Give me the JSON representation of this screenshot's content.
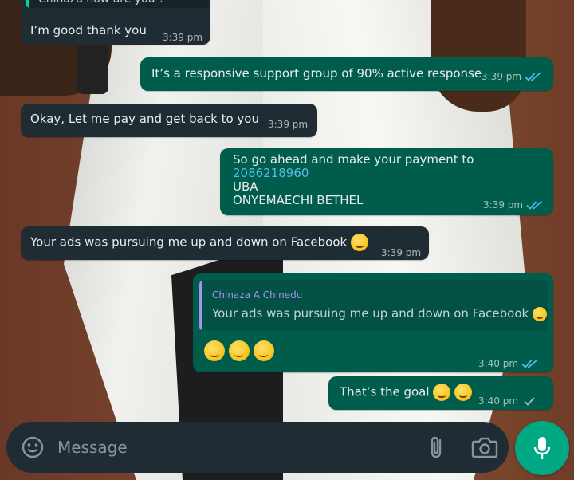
{
  "colors": {
    "incoming_bubble": "#202c33",
    "outgoing_bubble": "#005c4b",
    "read_ticks": "#53bdeb",
    "link": "#53bdeb",
    "reply_author": "#a791f0",
    "mic_button": "#00a884"
  },
  "messages": [
    {
      "direction": "in",
      "quoted_text": "Chinaza how are you ?",
      "text": "I’m good thank you",
      "time": "3:39 pm"
    },
    {
      "direction": "out",
      "text": "It’s a responsive support group of 90% active response",
      "time": "3:39 pm",
      "status": "read"
    },
    {
      "direction": "in",
      "text": "Okay, Let me pay and get back to you",
      "time": "3:39 pm"
    },
    {
      "direction": "out",
      "lines": [
        "So go ahead and make your payment to",
        "2086218960",
        "UBA",
        "ONYEMAECHI BETHEL"
      ],
      "time": "3:39 pm",
      "status": "read"
    },
    {
      "direction": "in",
      "text": "Your ads was pursuing me up and down on Facebook",
      "emoji": "rolling-on-floor-laughing",
      "time": "3:39 pm"
    },
    {
      "direction": "out",
      "reply_to": {
        "author": "Chinaza A Chinedu",
        "text": "Your ads was pursuing me up and down on Facebook"
      },
      "emoji_count": 3,
      "emoji": "rolling-on-floor-laughing",
      "time": "3:40 pm",
      "status": "read"
    },
    {
      "direction": "out",
      "text": "That’s the goal",
      "emoji": "smiling-face",
      "emoji_count": 2,
      "time": "3:40 pm",
      "status": "sent"
    }
  ],
  "input": {
    "placeholder": "Message"
  },
  "icons": {
    "emoji": "emoji-icon",
    "attach": "paperclip-icon",
    "camera": "camera-icon",
    "mic": "microphone-icon",
    "read": "double-check-icon",
    "sent": "single-check-icon"
  }
}
